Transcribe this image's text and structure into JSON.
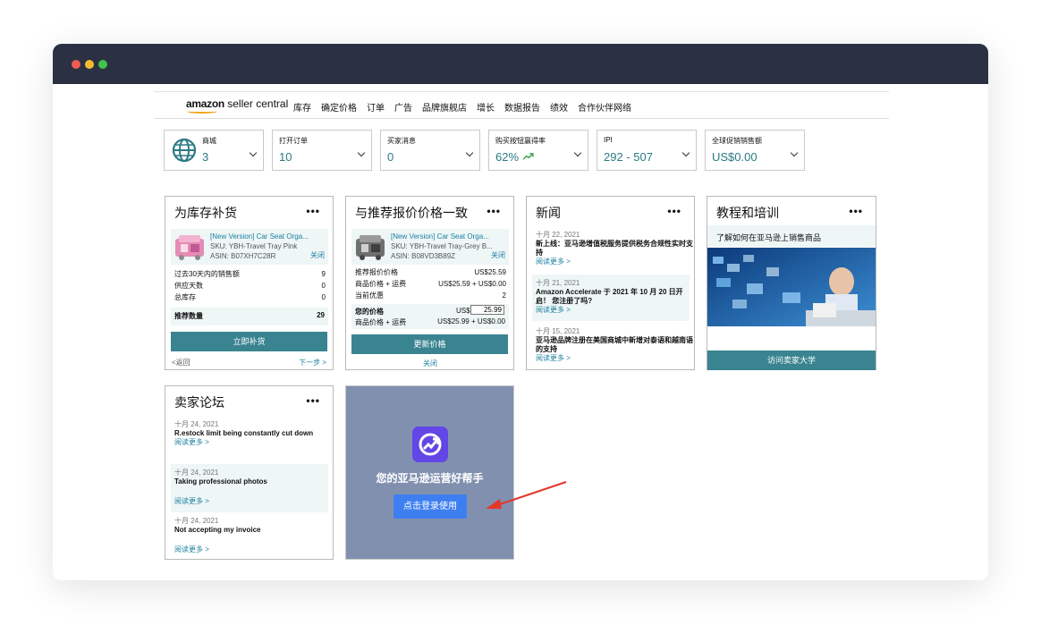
{
  "nav": {
    "logo_brand": "amazon",
    "logo_suffix": " seller central",
    "items": [
      "库存",
      "确定价格",
      "订单",
      "广告",
      "品牌旗舰店",
      "增长",
      "数据报告",
      "绩效",
      "合作伙伴网络"
    ]
  },
  "metrics": [
    {
      "label": "商城",
      "value": "3"
    },
    {
      "label": "打开订单",
      "value": "10"
    },
    {
      "label": "买家消息",
      "value": "0"
    },
    {
      "label": "购买按钮赢得率",
      "value": "62%"
    },
    {
      "label": "IPI",
      "value": "292 - 507"
    },
    {
      "label": "全球促销销售额",
      "value": "US$0.00"
    }
  ],
  "restock": {
    "title": "为库存补货",
    "more": "•••",
    "product_link": "[New Version] Car Seat Orga...",
    "sku": "SKU: YBH-Travel Tray Pink",
    "asin": "ASIN: B07XH7C28R",
    "close": "关闭",
    "rows": [
      {
        "label": "过去30天内的销售额",
        "value": "9"
      },
      {
        "label": "供应天数",
        "value": "0"
      },
      {
        "label": "总库存",
        "value": "0"
      }
    ],
    "recommend_label": "推荐数量",
    "recommend_value": "29",
    "button": "立即补货",
    "back": "<返回",
    "next": "下一步 >"
  },
  "pricing": {
    "title": "与推荐报价价格一致",
    "more": "•••",
    "product_link": "[New Version] Car Seat Orga...",
    "sku": "SKU: YBH-Travel Tray-Grey B...",
    "asin": "ASIN: B08VD3B89Z",
    "close": "关闭",
    "rows": [
      {
        "label": "推荐报价价格",
        "value": "US$25.59"
      },
      {
        "label": "商品价格 + 运费",
        "value": "US$25.59 + US$0.00"
      },
      {
        "label": "当前优惠",
        "value": "2"
      }
    ],
    "your_price_label": "您的价格",
    "your_price_prefix": "US$",
    "your_price_value": "25.99",
    "your_total_label": "商品价格 + 运费",
    "your_total_value": "US$25.99 + US$0.00",
    "button": "更新价格",
    "close_bottom": "关闭"
  },
  "news": {
    "title": "新闻",
    "more": "•••",
    "items": [
      {
        "date": "十月 22, 2021",
        "headline": "新上线：亚马逊增值税服务提供税务合规性实时支持",
        "link": "阅读更多 >"
      },
      {
        "date": "十月 21, 2021",
        "headline": "Amazon Accelerate 于 2021 年 10 月 20 日开启！ 您注册了吗?",
        "link": "阅读更多 >"
      },
      {
        "date": "十月 15, 2021",
        "headline": "亚马逊品牌注册在美国商城中新增对泰语和越南语的支持",
        "link": "阅读更多 >"
      }
    ]
  },
  "training": {
    "title": "教程和培训",
    "more": "•••",
    "subtitle": "了解如何在亚马逊上销售商品",
    "button": "访问卖家大学"
  },
  "forum": {
    "title": "卖家论坛",
    "more": "•••",
    "items": [
      {
        "date": "十月 24, 2021",
        "headline": "R.estock limit being constantly cut down",
        "link": "阅读更多 >"
      },
      {
        "date": "十月 24, 2021",
        "headline": "Taking professional photos",
        "link": "阅读更多 >"
      },
      {
        "date": "十月 24, 2021",
        "headline": "Not accepting my invoice",
        "link": "阅读更多 >"
      }
    ]
  },
  "promo": {
    "tagline": "您的亚马逊运营好帮手",
    "button": "点击登录使用"
  },
  "colors": {
    "titlebar": "#2b3143",
    "teal_button": "#3a8491",
    "promo_bg": "#8290b0",
    "promo_button": "#3d7ff0",
    "arrow": "#e2382c"
  }
}
